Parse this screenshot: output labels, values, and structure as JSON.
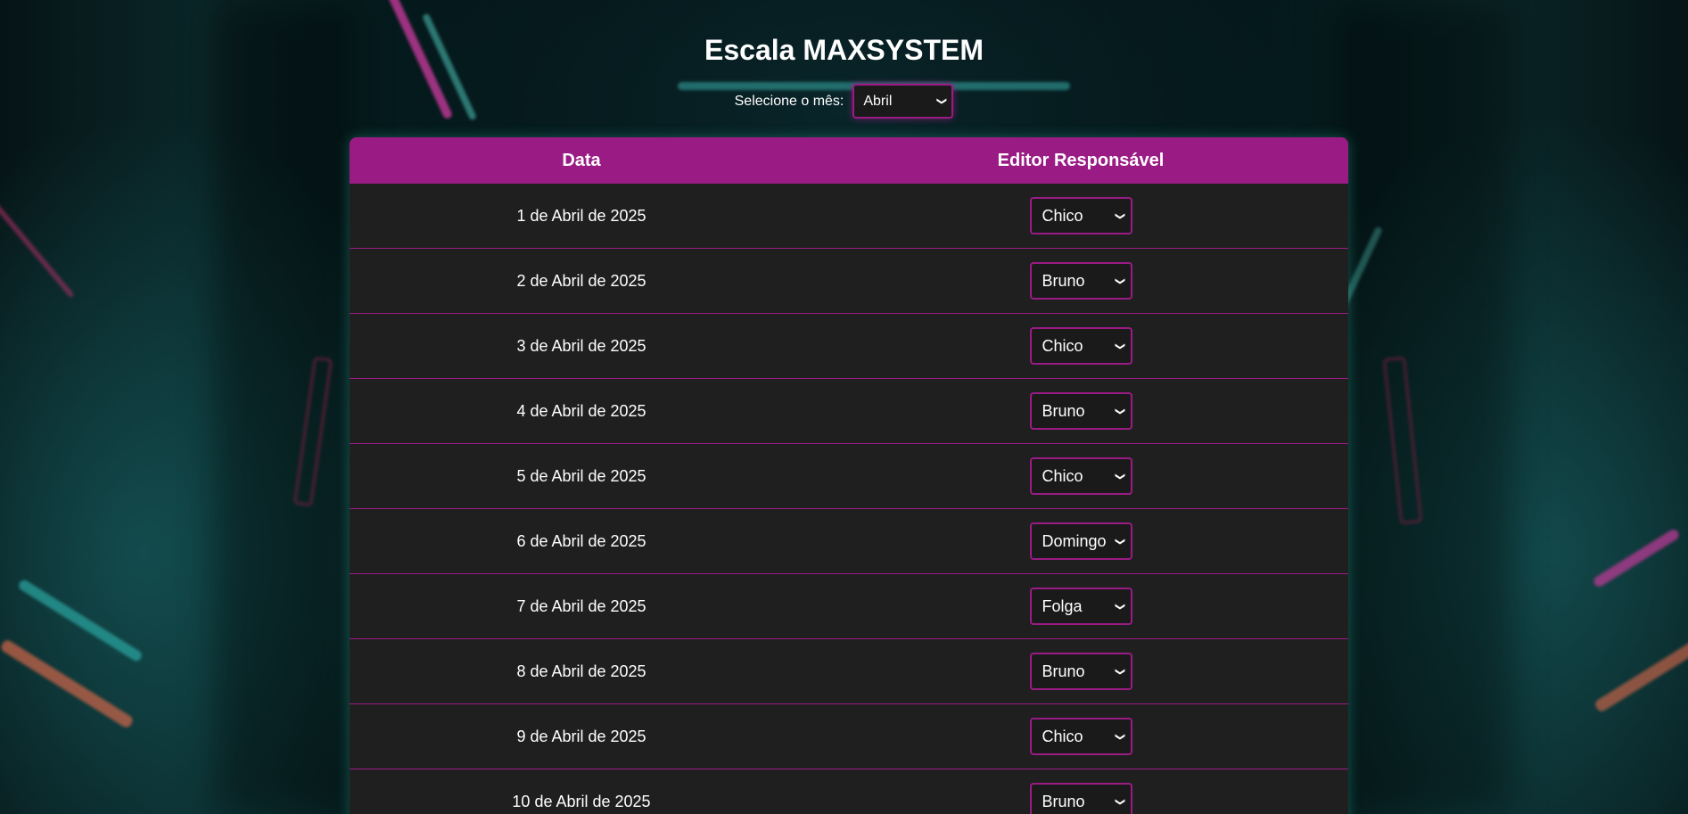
{
  "page": {
    "title": "Escala MAXSYSTEM",
    "month_label": "Selecione o mês:",
    "month_value": "Abril"
  },
  "table": {
    "headers": {
      "date": "Data",
      "editor": "Editor Responsável"
    },
    "rows": [
      {
        "date": "1 de Abril de 2025",
        "editor": "Chico"
      },
      {
        "date": "2 de Abril de 2025",
        "editor": "Bruno"
      },
      {
        "date": "3 de Abril de 2025",
        "editor": "Chico"
      },
      {
        "date": "4 de Abril de 2025",
        "editor": "Bruno"
      },
      {
        "date": "5 de Abril de 2025",
        "editor": "Chico"
      },
      {
        "date": "6 de Abril de 2025",
        "editor": "Domingo"
      },
      {
        "date": "7 de Abril de 2025",
        "editor": "Folga"
      },
      {
        "date": "8 de Abril de 2025",
        "editor": "Bruno"
      },
      {
        "date": "9 de Abril de 2025",
        "editor": "Chico"
      },
      {
        "date": "10 de Abril de 2025",
        "editor": "Bruno"
      }
    ]
  },
  "icons": {
    "dropdown": "chevron-down-icon"
  },
  "colors": {
    "accent": "#9b1b85",
    "table_bg": "#1f1f1f",
    "text": "#ffffff"
  }
}
